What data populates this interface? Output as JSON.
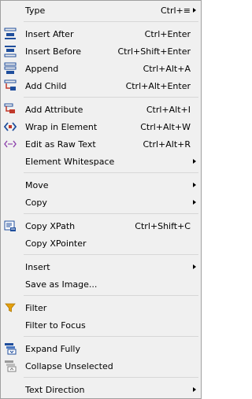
{
  "menu": {
    "items": [
      {
        "kind": "item",
        "name": "menu-item-type",
        "label": "Type",
        "shortcut": "Ctrl+≡",
        "submenu": true,
        "icon": null
      },
      {
        "kind": "sep"
      },
      {
        "kind": "item",
        "name": "menu-item-insert-after",
        "label": "Insert After",
        "shortcut": "Ctrl+Enter",
        "icon": "insert-after-icon"
      },
      {
        "kind": "item",
        "name": "menu-item-insert-before",
        "label": "Insert Before",
        "shortcut": "Ctrl+Shift+Enter",
        "icon": "insert-before-icon"
      },
      {
        "kind": "item",
        "name": "menu-item-append",
        "label": "Append",
        "shortcut": "Ctrl+Alt+A",
        "icon": "append-icon"
      },
      {
        "kind": "item",
        "name": "menu-item-add-child",
        "label": "Add Child",
        "shortcut": "Ctrl+Alt+Enter",
        "icon": "add-child-icon"
      },
      {
        "kind": "sep"
      },
      {
        "kind": "item",
        "name": "menu-item-add-attribute",
        "label": "Add Attribute",
        "shortcut": "Ctrl+Alt+I",
        "icon": "add-attribute-icon"
      },
      {
        "kind": "item",
        "name": "menu-item-wrap-in-element",
        "label": "Wrap in Element",
        "shortcut": "Ctrl+Alt+W",
        "icon": "wrap-element-icon"
      },
      {
        "kind": "item",
        "name": "menu-item-edit-raw-text",
        "label": "Edit as Raw Text",
        "shortcut": "Ctrl+Alt+R",
        "icon": "raw-text-icon"
      },
      {
        "kind": "item",
        "name": "menu-item-element-whitespace",
        "label": "Element Whitespace",
        "shortcut": "",
        "submenu": true,
        "icon": null
      },
      {
        "kind": "sep"
      },
      {
        "kind": "item",
        "name": "menu-item-move",
        "label": "Move",
        "shortcut": "",
        "submenu": true,
        "icon": null
      },
      {
        "kind": "item",
        "name": "menu-item-copy",
        "label": "Copy",
        "shortcut": "",
        "submenu": true,
        "icon": null
      },
      {
        "kind": "sep"
      },
      {
        "kind": "item",
        "name": "menu-item-copy-xpath",
        "label": "Copy XPath",
        "shortcut": "Ctrl+Shift+C",
        "icon": "copy-xpath-icon"
      },
      {
        "kind": "item",
        "name": "menu-item-copy-xpointer",
        "label": "Copy XPointer",
        "shortcut": "",
        "icon": null
      },
      {
        "kind": "sep"
      },
      {
        "kind": "item",
        "name": "menu-item-insert",
        "label": "Insert",
        "shortcut": "",
        "submenu": true,
        "icon": null
      },
      {
        "kind": "item",
        "name": "menu-item-save-as-image",
        "label": "Save as Image...",
        "shortcut": "",
        "icon": null
      },
      {
        "kind": "sep"
      },
      {
        "kind": "item",
        "name": "menu-item-filter",
        "label": "Filter",
        "shortcut": "",
        "icon": "filter-icon"
      },
      {
        "kind": "item",
        "name": "menu-item-filter-to-focus",
        "label": "Filter to Focus",
        "shortcut": "",
        "icon": null
      },
      {
        "kind": "sep"
      },
      {
        "kind": "item",
        "name": "menu-item-expand-fully",
        "label": "Expand Fully",
        "shortcut": "",
        "icon": "expand-fully-icon"
      },
      {
        "kind": "item",
        "name": "menu-item-collapse-unselected",
        "label": "Collapse Unselected",
        "shortcut": "",
        "icon": "collapse-unselected-icon"
      },
      {
        "kind": "sep"
      },
      {
        "kind": "item",
        "name": "menu-item-text-direction",
        "label": "Text Direction",
        "shortcut": "",
        "submenu": true,
        "icon": null
      }
    ]
  },
  "colors": {
    "menu_bg": "#f0f0f0",
    "border": "#a0a0a0",
    "separator": "#d7d7d7",
    "icon_blue": "#1f4e9c",
    "icon_red": "#c0392b",
    "icon_purple": "#8e44ad",
    "icon_gold": "#e5a00d"
  }
}
